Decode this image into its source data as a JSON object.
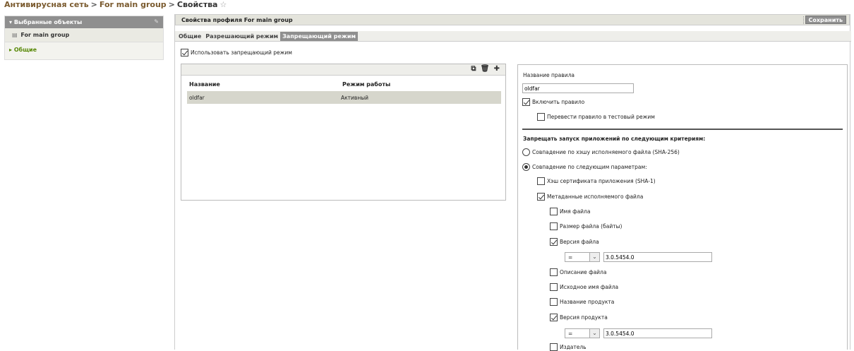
{
  "breadcrumb": {
    "root": "Антивирусная сеть",
    "group": "For main group",
    "current": "Свойства",
    "sep": ">",
    "star": "☆"
  },
  "sidebar": {
    "header": "Выбранные объекты",
    "object": "For main group",
    "section": "Общие"
  },
  "main": {
    "title": "Свойства профиля For main group",
    "save_label": "Сохранить",
    "tabs": [
      "Общие",
      "Разрешающий режим",
      "Запрещающий режим"
    ],
    "active_tab": "Запрещающий режим",
    "use_mode_label": "Использовать запрещающий режим",
    "use_mode_checked": true
  },
  "rules": {
    "columns": [
      "Название",
      "Режим работы"
    ],
    "rows": [
      {
        "name": "oldfar",
        "mode": "Активный"
      }
    ]
  },
  "props": {
    "rule_name_label": "Название правила",
    "rule_name_value": "oldfar",
    "enable_rule": "Включить правило",
    "test_mode": "Перевести правило в тестовый режим",
    "criteria_title": "Запрещать запуск приложений по следующим критериям:",
    "hash_match": "Совпадение по хэшу исполняемого файла (SHA-256)",
    "param_match": "Совпадение по следующим параметрам:",
    "cert_hash": "Хэш сертификата приложения (SHA-1)",
    "metadata": "Метаданные исполняемого файла",
    "file_name": "Имя файла",
    "file_size": "Размер файла (байты)",
    "file_version": "Версия файла",
    "file_version_op": "=",
    "file_version_value": "3.0.5454.0",
    "file_desc": "Описание файла",
    "orig_name": "Исходное имя файла",
    "product_name": "Название продукта",
    "product_version": "Версия продукта",
    "product_version_op": "=",
    "product_version_value": "3.0.5454.0",
    "publisher": "Издатель"
  }
}
